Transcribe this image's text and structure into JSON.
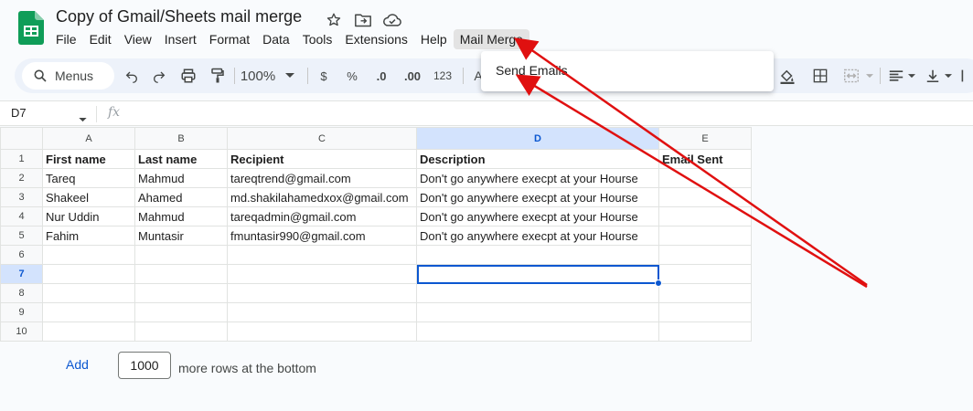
{
  "doc": {
    "title": "Copy of Gmail/Sheets mail merge",
    "icons": [
      "star-icon",
      "move-to-folder-icon",
      "cloud-saved-icon"
    ]
  },
  "menubar": [
    {
      "label": "File"
    },
    {
      "label": "Edit"
    },
    {
      "label": "View"
    },
    {
      "label": "Insert"
    },
    {
      "label": "Format"
    },
    {
      "label": "Data"
    },
    {
      "label": "Tools"
    },
    {
      "label": "Extensions"
    },
    {
      "label": "Help"
    },
    {
      "label": "Mail Merge"
    }
  ],
  "toolbar": {
    "search_label": "Menus",
    "zoom": "100%",
    "currency": "$",
    "percent": "%",
    "decrease_decimal": ".0",
    "increase_decimal": ".00",
    "number_format": "123",
    "font_truncated": "A"
  },
  "formula_bar": {
    "name_box": "D7",
    "fx": "fx"
  },
  "dropdown": {
    "items": [
      "Send Emails"
    ]
  },
  "sheet": {
    "columns": [
      "A",
      "B",
      "C",
      "D",
      "E"
    ],
    "selected_column": "D",
    "selected_row": "7",
    "rows": [
      {
        "num": "1",
        "cells": [
          "First name",
          "Last name",
          "Recipient",
          "Description",
          "Email Sent"
        ]
      },
      {
        "num": "2",
        "cells": [
          "Tareq",
          "Mahmud",
          "tareqtrend@gmail.com",
          "Don't go anywhere execpt at your Hourse",
          ""
        ]
      },
      {
        "num": "3",
        "cells": [
          "Shakeel",
          "Ahamed",
          "md.shakilahamedxox@gmail.com",
          "Don't go anywhere execpt at your Hourse",
          ""
        ]
      },
      {
        "num": "4",
        "cells": [
          "Nur Uddin",
          "Mahmud",
          "tareqadmin@gmail.com",
          "Don't go anywhere execpt at your Hourse",
          ""
        ]
      },
      {
        "num": "5",
        "cells": [
          "Fahim",
          "Muntasir",
          "fmuntasir990@gmail.com",
          "Don't go anywhere execpt at your Hourse",
          ""
        ]
      },
      {
        "num": "6",
        "cells": [
          "",
          "",
          "",
          "",
          ""
        ]
      },
      {
        "num": "7",
        "cells": [
          "",
          "",
          "",
          "",
          ""
        ]
      },
      {
        "num": "8",
        "cells": [
          "",
          "",
          "",
          "",
          ""
        ]
      },
      {
        "num": "9",
        "cells": [
          "",
          "",
          "",
          "",
          ""
        ]
      },
      {
        "num": "10",
        "cells": [
          "",
          "",
          "",
          "",
          ""
        ]
      }
    ]
  },
  "footer": {
    "add_label": "Add",
    "rows_value": "1000",
    "more_rows_label": "more rows at the bottom"
  },
  "colors": {
    "accent": "#0b57d0",
    "annotation_arrow": "#e01010",
    "sheets_green": "#0f9d58"
  }
}
